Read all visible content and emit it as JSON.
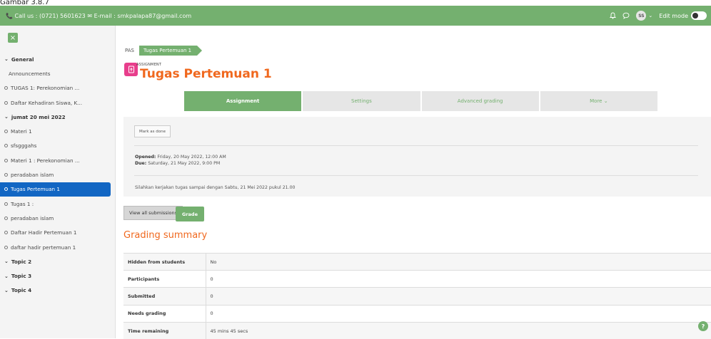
{
  "caption": "Gambar 3.8.7",
  "topbar": {
    "contact": "📞 Call us : (0721) 5601623 ✉ E-mail : smkpalapa87@gmail.com",
    "avatar_initials": "SS",
    "edit_mode_label": "Edit mode",
    "icons": [
      "bell-icon",
      "chat-icon",
      "chevron-down-icon",
      "toggle"
    ]
  },
  "sidebar": {
    "items": [
      {
        "type": "section",
        "label": "General"
      },
      {
        "type": "plain",
        "label": "Announcements"
      },
      {
        "type": "activity",
        "label": "TUGAS 1: Perekonomian ..."
      },
      {
        "type": "activity",
        "label": "Daftar Kehadiran Siswa, K..."
      },
      {
        "type": "section",
        "label": "jumat 20 mei 2022"
      },
      {
        "type": "activity",
        "label": "Materi 1"
      },
      {
        "type": "activity",
        "label": "sfsgggahs"
      },
      {
        "type": "activity",
        "label": "Materi 1 : Perekonomian ..."
      },
      {
        "type": "activity",
        "label": "peradaban islam"
      },
      {
        "type": "activity",
        "label": "Tugas Pertemuan 1",
        "active": true
      },
      {
        "type": "activity",
        "label": "Tugas 1 :"
      },
      {
        "type": "activity",
        "label": "peradaban islam"
      },
      {
        "type": "activity",
        "label": "Daftar Hadir Pertemuan 1"
      },
      {
        "type": "activity",
        "label": "daftar hadir pertemuan 1"
      },
      {
        "type": "section",
        "label": "Topic 2"
      },
      {
        "type": "section",
        "label": "Topic 3"
      },
      {
        "type": "section",
        "label": "Topic 4"
      }
    ]
  },
  "breadcrumb": {
    "first": "PAS",
    "active": "Tugas Pertemuan 1"
  },
  "activity": {
    "label": "ASSIGNMENT",
    "title": "Tugas Pertemuan 1"
  },
  "tabs": [
    {
      "label": "Assignment",
      "active": true
    },
    {
      "label": "Settings"
    },
    {
      "label": "Advanced grading"
    },
    {
      "label": "More ⌄"
    }
  ],
  "panel": {
    "mark_done": "Mark as done",
    "opened_label": "Opened:",
    "opened_value": "Friday, 20 May 2022, 12:00 AM",
    "due_label": "Due:",
    "due_value": "Saturday, 21 May 2022, 9:00 PM",
    "instruction": "Silahkan kerjakan tugas sampai dengan Sabtu, 21 Mei 2022 pukul 21.00"
  },
  "buttons": {
    "view_all": "View all submissions",
    "grade": "Grade"
  },
  "summary": {
    "title": "Grading summary",
    "rows": [
      {
        "key": "Hidden from students",
        "value": "No"
      },
      {
        "key": "Participants",
        "value": "0"
      },
      {
        "key": "Submitted",
        "value": "0"
      },
      {
        "key": "Needs grading",
        "value": "0"
      },
      {
        "key": "Time remaining",
        "value": "45 mins 45 secs"
      }
    ]
  },
  "help": "?",
  "colors": {
    "brand": "#74b06f",
    "title": "#f0681e",
    "active_nav": "#1266c3",
    "assignment_icon": "#e83e8c"
  }
}
